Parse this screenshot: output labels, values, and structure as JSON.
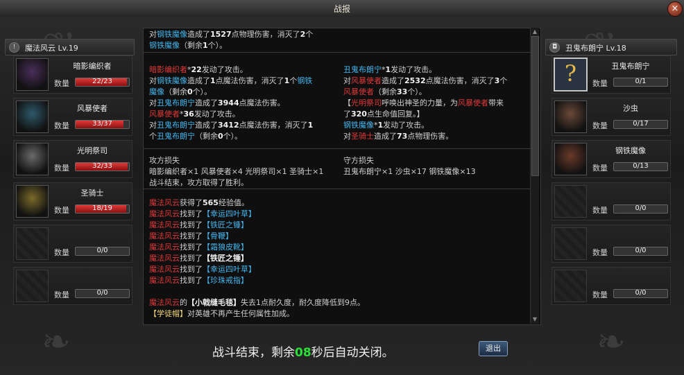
{
  "window": {
    "title": "战报",
    "close_glyph": "×"
  },
  "left_player": {
    "name": "魔法风云",
    "level": "Lv.19"
  },
  "right_player": {
    "name": "丑鬼布朗宁",
    "level": "Lv.18"
  },
  "qty_label": "数量",
  "left_units": [
    {
      "name": "暗影编织者",
      "count": "22/23",
      "fill": 0.956,
      "portrait": "shadow-weaver",
      "color": "#4a2e5a"
    },
    {
      "name": "风暴使者",
      "count": "33/37",
      "fill": 0.892,
      "portrait": "storm-envoy",
      "color": "#2e5a6a"
    },
    {
      "name": "光明祭司",
      "count": "32/33",
      "fill": 0.97,
      "portrait": "light-priest",
      "color": "#6a6a6a"
    },
    {
      "name": "圣骑士",
      "count": "18/19",
      "fill": 0.947,
      "portrait": "paladin",
      "color": "#7a6a2a"
    },
    {
      "name": "",
      "count": "0/0",
      "fill": 0,
      "portrait": "",
      "color": ""
    },
    {
      "name": "",
      "count": "0/0",
      "fill": 0,
      "portrait": "",
      "color": ""
    }
  ],
  "right_units": [
    {
      "name": "丑鬼布朗宁",
      "count": "0/1",
      "fill": 0,
      "portrait": "unknown-hero",
      "color": ""
    },
    {
      "name": "沙虫",
      "count": "0/17",
      "fill": 0,
      "portrait": "sandworm",
      "color": "#6a4a3a"
    },
    {
      "name": "钢铁魔像",
      "count": "0/13",
      "fill": 0,
      "portrait": "iron-golem",
      "color": "#6a3a2a"
    },
    {
      "name": "",
      "count": "0/0",
      "fill": 0,
      "portrait": "",
      "color": ""
    },
    {
      "name": "",
      "count": "0/0",
      "fill": 0,
      "portrait": "",
      "color": ""
    },
    {
      "name": "",
      "count": "0/0",
      "fill": 0,
      "portrait": "",
      "color": ""
    }
  ],
  "log_top": [
    [
      [
        "对",
        ""
      ],
      [
        "钢铁魔像",
        "b"
      ],
      [
        "造成了",
        ""
      ],
      [
        "1527",
        "w"
      ],
      [
        "点物理伤害，消灭了",
        ""
      ],
      [
        "2",
        "w"
      ],
      [
        "个",
        ""
      ]
    ],
    [
      [
        "钢铁魔像",
        "b"
      ],
      [
        "（剩余",
        ""
      ],
      [
        "1",
        "w"
      ],
      [
        "个）。",
        ""
      ]
    ]
  ],
  "log_left": [
    [
      [
        "暗影编织者",
        "r"
      ],
      [
        "*",
        ""
      ],
      [
        "22",
        "w"
      ],
      [
        "发动了攻击。",
        ""
      ]
    ],
    [
      [
        "对",
        ""
      ],
      [
        "钢铁魔像",
        "b"
      ],
      [
        "造成了",
        ""
      ],
      [
        "1",
        "w"
      ],
      [
        "点魔法伤害，消灭了",
        ""
      ],
      [
        "1",
        "w"
      ],
      [
        "个",
        ""
      ],
      [
        "钢铁",
        "b"
      ]
    ],
    [
      [
        "魔像",
        "b"
      ],
      [
        "（剩余",
        ""
      ],
      [
        "0",
        "w"
      ],
      [
        "个）。",
        ""
      ]
    ],
    [
      [
        "对",
        ""
      ],
      [
        "丑鬼布朗宁",
        "b"
      ],
      [
        "造成了",
        ""
      ],
      [
        "3944",
        "w"
      ],
      [
        "点魔法伤害。",
        ""
      ]
    ],
    [
      [
        "风暴使者",
        "r"
      ],
      [
        "*",
        ""
      ],
      [
        "36",
        "w"
      ],
      [
        "发动了攻击。",
        ""
      ]
    ],
    [
      [
        "对",
        ""
      ],
      [
        "丑鬼布朗宁",
        "b"
      ],
      [
        "造成了",
        ""
      ],
      [
        "3412",
        "w"
      ],
      [
        "点魔法伤害，消灭了",
        ""
      ],
      [
        "1",
        "w"
      ]
    ],
    [
      [
        "个",
        ""
      ],
      [
        "丑鬼布朗宁",
        "b"
      ],
      [
        "（剩余",
        ""
      ],
      [
        "0",
        "w"
      ],
      [
        "个）。",
        ""
      ]
    ]
  ],
  "log_right": [
    [
      [
        "丑鬼布朗宁",
        "b"
      ],
      [
        "*",
        ""
      ],
      [
        "1",
        "w"
      ],
      [
        "发动了攻击。",
        ""
      ]
    ],
    [
      [
        "对",
        ""
      ],
      [
        "风暴使者",
        "r"
      ],
      [
        "造成了",
        ""
      ],
      [
        "2532",
        "w"
      ],
      [
        "点魔法伤害，消灭了",
        ""
      ],
      [
        "3",
        "w"
      ],
      [
        "个",
        ""
      ]
    ],
    [
      [
        "风暴使者",
        "r"
      ],
      [
        "（剩余",
        ""
      ],
      [
        "33",
        "w"
      ],
      [
        "个）。",
        ""
      ]
    ],
    [
      [
        "【",
        ""
      ],
      [
        "光明祭司",
        "r"
      ],
      [
        "呼唤出神圣的力量，为",
        ""
      ],
      [
        "风暴使者",
        "r"
      ],
      [
        "带来",
        ""
      ]
    ],
    [
      [
        "了",
        ""
      ],
      [
        "320",
        "w"
      ],
      [
        "点生命值回复。】",
        ""
      ]
    ],
    [
      [
        "钢铁魔像",
        "b"
      ],
      [
        "*",
        ""
      ],
      [
        "1",
        "w"
      ],
      [
        "发动了攻击。",
        ""
      ]
    ],
    [
      [
        "对",
        ""
      ],
      [
        "圣骑士",
        "r"
      ],
      [
        "造成了",
        ""
      ],
      [
        "73",
        "w"
      ],
      [
        "点物理伤害。",
        ""
      ]
    ]
  ],
  "losses": {
    "attacker_title": "攻方损失",
    "attacker_list": "暗影编织者×1 风暴使者×4 光明祭司×1 圣骑士×1",
    "result": "战斗结束，攻方取得了胜利。",
    "defender_title": "守方损失",
    "defender_list": "丑鬼布朗宁×1 沙虫×17 钢铁魔像×13"
  },
  "rewards": [
    [
      [
        "魔法风云",
        "r"
      ],
      [
        "获得了",
        ""
      ],
      [
        "565",
        "w"
      ],
      [
        "经验值。",
        ""
      ]
    ],
    [
      [
        "魔法风云",
        "r"
      ],
      [
        "找到了",
        ""
      ],
      [
        "【幸运四叶草】",
        "b"
      ]
    ],
    [
      [
        "魔法风云",
        "r"
      ],
      [
        "找到了",
        ""
      ],
      [
        "【铁匠之锤】",
        "b"
      ]
    ],
    [
      [
        "魔法风云",
        "r"
      ],
      [
        "找到了",
        ""
      ],
      [
        "【骨鞭】",
        "b"
      ]
    ],
    [
      [
        "魔法风云",
        "r"
      ],
      [
        "找到了",
        ""
      ],
      [
        "【霜狼皮靴】",
        "b"
      ]
    ],
    [
      [
        "魔法风云",
        "r"
      ],
      [
        "找到了",
        ""
      ],
      [
        "【铁匠之锤】",
        "w"
      ]
    ],
    [
      [
        "魔法风云",
        "r"
      ],
      [
        "找到了",
        ""
      ],
      [
        "【幸运四叶草】",
        "b"
      ]
    ],
    [
      [
        "魔法风云",
        "r"
      ],
      [
        "找到了",
        ""
      ],
      [
        "【珍珠戒指】",
        "b"
      ]
    ]
  ],
  "durability": [
    [
      [
        "魔法风云",
        "r"
      ],
      [
        "的",
        ""
      ],
      [
        "【小戟缝毛毯】",
        "w"
      ],
      [
        "失去1点耐久度，耐久度降低到9点。",
        ""
      ]
    ],
    [
      [
        "【学徒帽】",
        "y"
      ],
      [
        "对英雄不再产生任何属性加成。",
        ""
      ]
    ]
  ],
  "footer": {
    "prefix": "战斗结束，剩余",
    "seconds": "08",
    "suffix": "秒后自动关闭。",
    "exit_label": "退出"
  }
}
